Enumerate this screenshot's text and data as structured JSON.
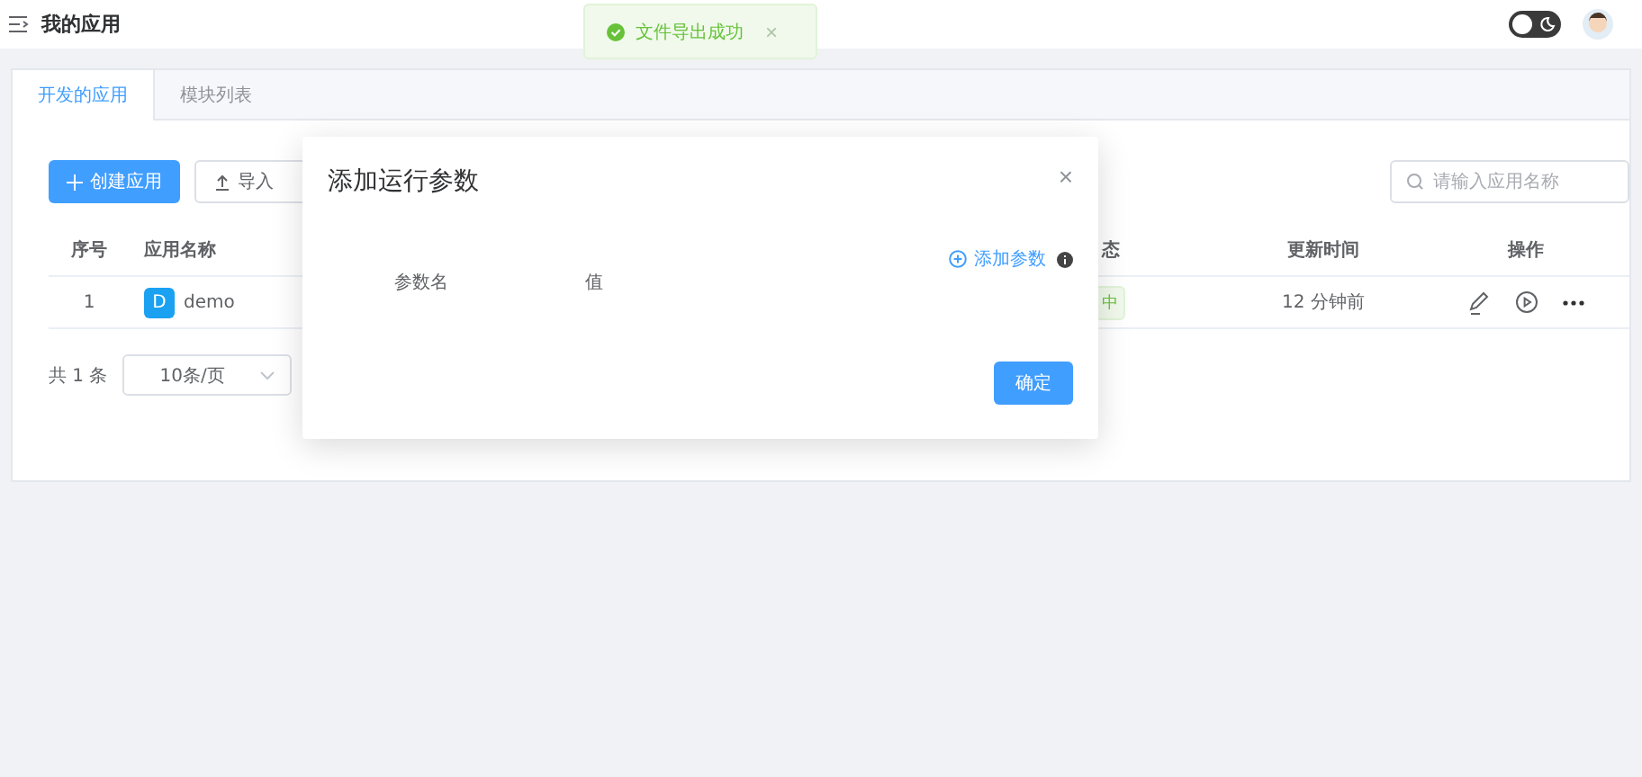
{
  "header": {
    "title": "我的应用",
    "dark_mode": false
  },
  "toast": {
    "message": "文件导出成功",
    "close": "×"
  },
  "tabs": [
    {
      "label": "开发的应用",
      "selected": true
    },
    {
      "label": "模块列表",
      "selected": false
    }
  ],
  "toolbar": {
    "create_button": "创建应用",
    "import_button": "导入",
    "search": {
      "placeholder": "请输入应用名称"
    }
  },
  "table": {
    "columns": [
      "序号",
      "应用名称",
      "态",
      "更新时间",
      "操作"
    ],
    "rows": [
      {
        "index": "1",
        "avatar": "D",
        "name": "demo",
        "status": "中",
        "updated": "12 分钟前"
      }
    ]
  },
  "pagination": {
    "total": "共 1 条",
    "page_size": "10条/页"
  },
  "dialog": {
    "title": "添加运行参数",
    "close": "×",
    "add_link": "添加参数",
    "columns": [
      "参数名",
      "值"
    ],
    "confirm": "确定"
  }
}
